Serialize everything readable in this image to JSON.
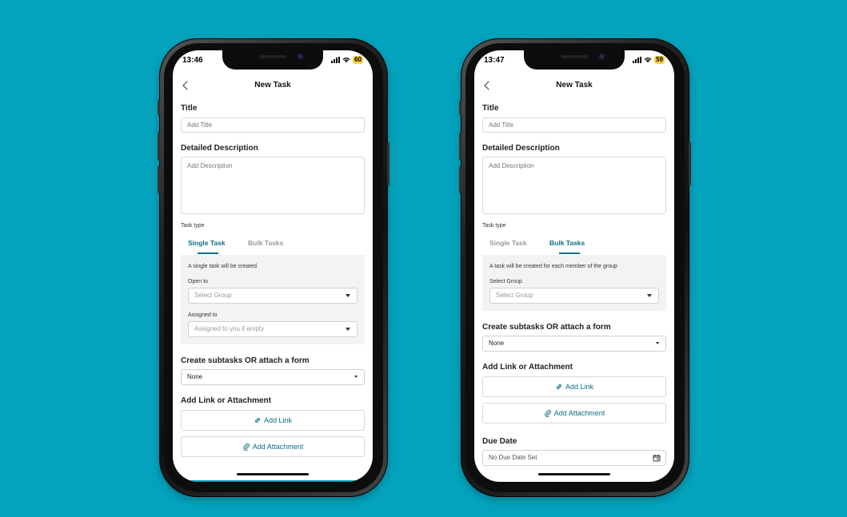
{
  "colors": {
    "background": "#04a3bd",
    "accent": "#0e6e85",
    "battery": "#f4d03f"
  },
  "left_phone": {
    "status": {
      "time": "13:46",
      "battery": "60"
    },
    "header": {
      "title": "New Task"
    },
    "title_label": "Title",
    "title_placeholder": "Add Title",
    "description_label": "Detailed Description",
    "description_placeholder": "Add Description",
    "task_type_label": "Task type",
    "tabs": [
      {
        "label": "Single Task",
        "active": true
      },
      {
        "label": "Bulk Tasks",
        "active": false
      }
    ],
    "panel_info": "A single task will be created",
    "open_to_label": "Open to",
    "open_to_placeholder": "Select Group",
    "assigned_to_label": "Assigned to",
    "assigned_to_placeholder": "Assigned to you if empty",
    "subtasks_label": "Create subtasks OR attach a form",
    "subtasks_value": "None",
    "link_label": "Add Link or Attachment",
    "add_link": "Add Link",
    "add_attachment": "Add Attachment"
  },
  "right_phone": {
    "status": {
      "time": "13:47",
      "battery": "59"
    },
    "header": {
      "title": "New Task"
    },
    "title_label": "Title",
    "title_placeholder": "Add Title",
    "description_label": "Detailed Description",
    "description_placeholder": "Add Description",
    "task_type_label": "Task type",
    "tabs": [
      {
        "label": "Single Task",
        "active": false
      },
      {
        "label": "Bulk Tasks",
        "active": true
      }
    ],
    "panel_info": "A task will be created for each member of the group",
    "select_group_label": "Select Group",
    "select_group_placeholder": "Select Group",
    "subtasks_label": "Create subtasks OR attach a form",
    "subtasks_value": "None",
    "link_label": "Add Link or Attachment",
    "add_link": "Add Link",
    "add_attachment": "Add Attachment",
    "due_date_label": "Due Date",
    "due_date_value": "No Due Date Set"
  }
}
